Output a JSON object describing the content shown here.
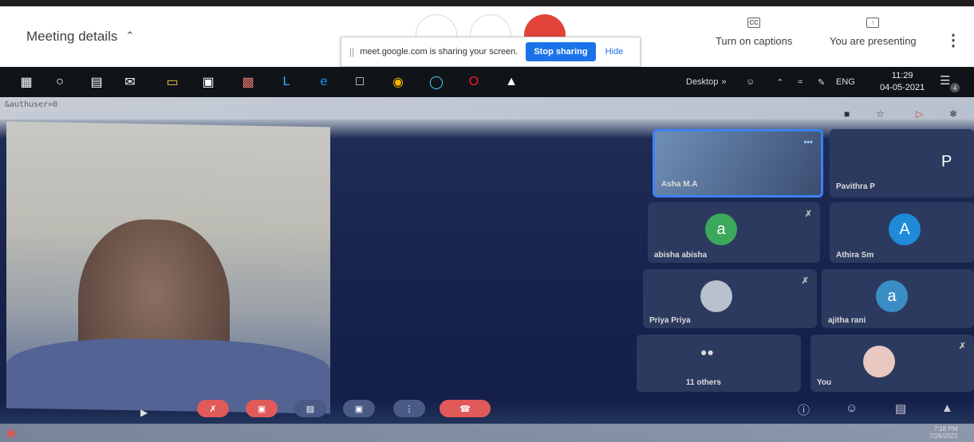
{
  "meet": {
    "meeting_details": "Meeting details",
    "share_banner": {
      "message": "meet.google.com is sharing your screen.",
      "stop": "Stop sharing",
      "hide": "Hide"
    },
    "captions": {
      "icon_text": "CC",
      "label": "Turn on captions"
    },
    "presenting": {
      "label": "You are presenting"
    }
  },
  "taskbar": {
    "desktop": "Desktop",
    "lang": "ENG",
    "time": "11:29",
    "date": "04-05-2021",
    "notifications": "4"
  },
  "photo": {
    "url_text": "&authuser=0",
    "tiles": [
      {
        "name": "Asha M.A"
      },
      {
        "name": "Pavithra P",
        "initial": "P"
      },
      {
        "name": "abisha abisha",
        "initial": "a",
        "color": "#3ca85b"
      },
      {
        "name": "Athira Sm",
        "initial": "A",
        "color": "#1f8ad8"
      },
      {
        "name": "Priya Priya"
      },
      {
        "name": "ajitha rani",
        "initial": "a",
        "color": "#3b8ec5"
      },
      {
        "name": "11 others"
      },
      {
        "name": "You"
      }
    ],
    "bottom_clock": {
      "time": "7:18 PM",
      "date": "7/26/2021"
    }
  }
}
